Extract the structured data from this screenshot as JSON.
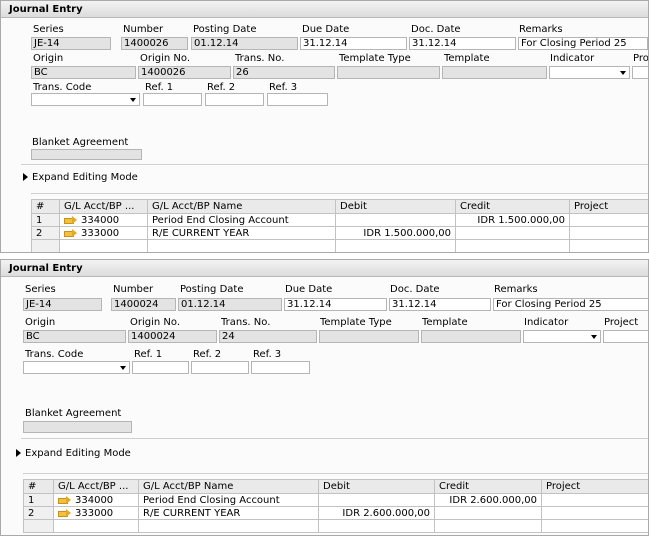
{
  "p1": {
    "title": "Journal Entry",
    "labels": {
      "series": "Series",
      "number": "Number",
      "posting_date": "Posting Date",
      "due_date": "Due Date",
      "doc_date": "Doc. Date",
      "remarks": "Remarks",
      "origin": "Origin",
      "origin_no": "Origin No.",
      "trans_no": "Trans. No.",
      "template_type": "Template Type",
      "template": "Template",
      "indicator": "Indicator",
      "project": "Pro",
      "trans_code": "Trans. Code",
      "ref1": "Ref. 1",
      "ref2": "Ref. 2",
      "ref3": "Ref. 3",
      "blanket": "Blanket Agreement",
      "expand": "Expand Editing Mode"
    },
    "values": {
      "series": "JE-14",
      "number": "1400026",
      "posting_date": "01.12.14",
      "due_date": "31.12.14",
      "doc_date": "31.12.14",
      "remarks": "For Closing Period 25",
      "origin": "BC",
      "origin_no": "1400026",
      "trans_no": "26"
    },
    "grid": {
      "headers": [
        "#",
        "G/L Acct/BP ...",
        "G/L Acct/BP Name",
        "Debit",
        "Credit",
        "Project"
      ],
      "rows": [
        {
          "num": "1",
          "acct": "334000",
          "name": "Period End Closing Account",
          "debit": "",
          "credit": "IDR 1.500.000,00",
          "project": ""
        },
        {
          "num": "2",
          "acct": "333000",
          "name": "R/E CURRENT YEAR",
          "debit": "IDR 1.500.000,00",
          "credit": "",
          "project": ""
        }
      ]
    }
  },
  "p2": {
    "title": "Journal Entry",
    "labels": {
      "series": "Series",
      "number": "Number",
      "posting_date": "Posting Date",
      "due_date": "Due Date",
      "doc_date": "Doc. Date",
      "remarks": "Remarks",
      "origin": "Origin",
      "origin_no": "Origin No.",
      "trans_no": "Trans. No.",
      "template_type": "Template Type",
      "template": "Template",
      "indicator": "Indicator",
      "project": "Project",
      "trans_code": "Trans. Code",
      "ref1": "Ref. 1",
      "ref2": "Ref. 2",
      "ref3": "Ref. 3",
      "blanket": "Blanket Agreement",
      "expand": "Expand Editing Mode"
    },
    "values": {
      "series": "JE-14",
      "number": "1400024",
      "posting_date": "01.12.14",
      "due_date": "31.12.14",
      "doc_date": "31.12.14",
      "remarks": "For Closing Period 25",
      "origin": "BC",
      "origin_no": "1400024",
      "trans_no": "24"
    },
    "grid": {
      "headers": [
        "#",
        "G/L Acct/BP ...",
        "G/L Acct/BP Name",
        "Debit",
        "Credit",
        "Project"
      ],
      "rows": [
        {
          "num": "1",
          "acct": "334000",
          "name": "Period End Closing Account",
          "debit": "",
          "credit": "IDR 2.600.000,00",
          "project": ""
        },
        {
          "num": "2",
          "acct": "333000",
          "name": "R/E CURRENT YEAR",
          "debit": "IDR 2.600.000,00",
          "credit": "",
          "project": ""
        }
      ]
    }
  }
}
